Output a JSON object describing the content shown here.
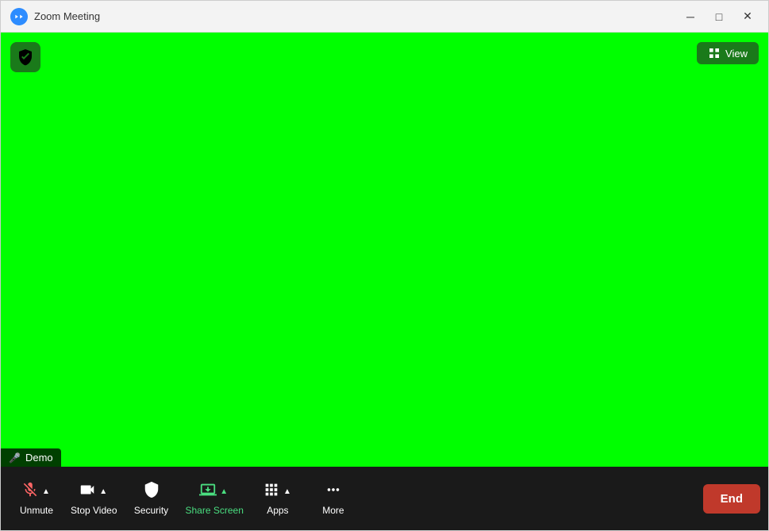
{
  "window": {
    "title": "Zoom Meeting",
    "logo_alt": "Zoom logo"
  },
  "title_bar": {
    "minimize_label": "─",
    "maximize_label": "□",
    "close_label": "✕"
  },
  "main": {
    "bg_color": "#00ff00",
    "demo_name": "Demo"
  },
  "view_button": {
    "label": "View"
  },
  "toolbar": {
    "items": [
      {
        "id": "unmute",
        "label": "Unmute",
        "active": false,
        "muted": true,
        "has_chevron": true
      },
      {
        "id": "stop-video",
        "label": "Stop Video",
        "active": false,
        "muted": false,
        "has_chevron": true
      },
      {
        "id": "security",
        "label": "Security",
        "active": false,
        "muted": false,
        "has_chevron": false
      },
      {
        "id": "share-screen",
        "label": "Share Screen",
        "active": true,
        "muted": false,
        "has_chevron": true
      },
      {
        "id": "apps",
        "label": "Apps",
        "active": false,
        "muted": false,
        "has_chevron": true
      },
      {
        "id": "more",
        "label": "More",
        "active": false,
        "muted": false,
        "has_chevron": false
      }
    ],
    "end_label": "End"
  }
}
